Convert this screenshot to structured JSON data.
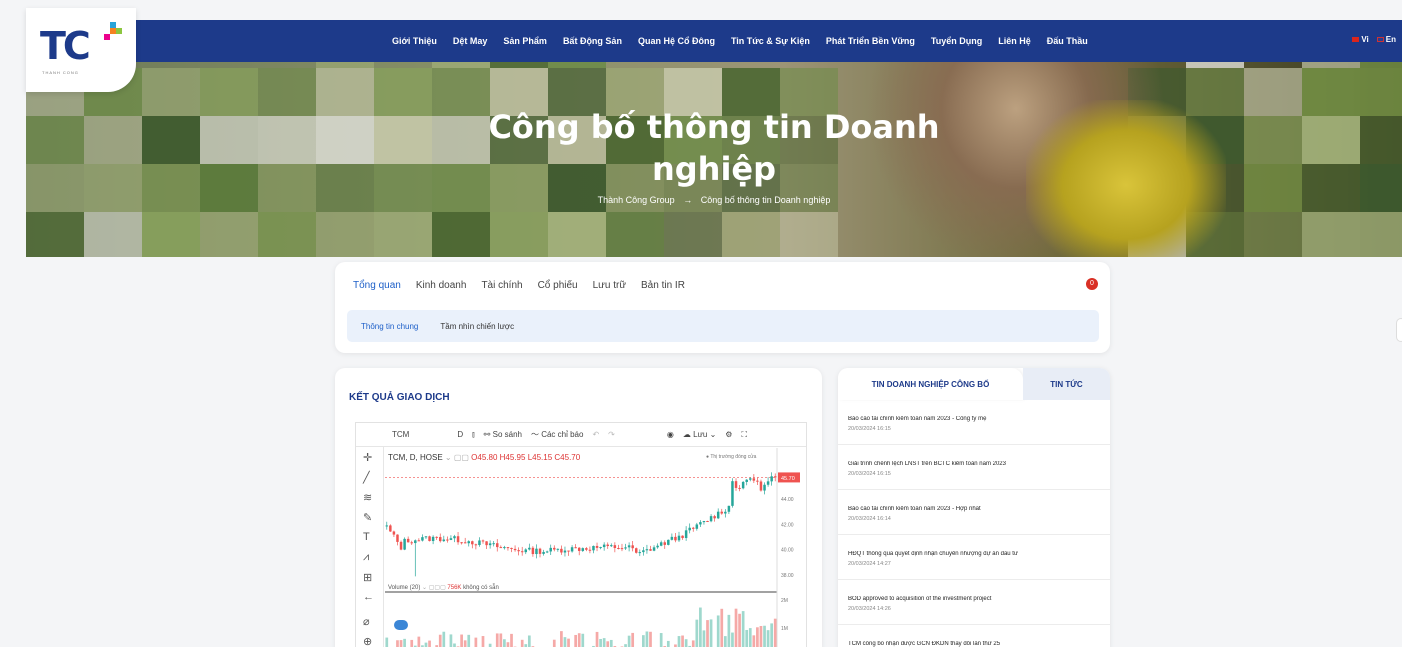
{
  "nav": {
    "items": [
      "Giới Thiệu",
      "Dệt May",
      "Sản Phẩm",
      "Bất Động Sản",
      "Quan Hệ Cổ Đông",
      "Tin Tức & Sự Kiện",
      "Phát Triển Bền Vững",
      "Tuyển Dụng",
      "Liên Hệ",
      "Đấu Thầu"
    ],
    "lang_vi": "Vi",
    "lang_en": "En"
  },
  "logo": {
    "text": "TC",
    "sub": "THANH CONG"
  },
  "hero": {
    "title_line1": "Công bố thông tin Doanh",
    "title_line2": "nghiệp",
    "breadcrumb_home": "Thành Công Group",
    "breadcrumb_sep": "→",
    "breadcrumb_current": "Công bố thông tin Doanh nghiệp"
  },
  "tabs": {
    "main": [
      "Tổng quan",
      "Kinh doanh",
      "Tài chính",
      "Cổ phiếu",
      "Lưu trữ",
      "Bản tin IR"
    ],
    "active_main": 0,
    "sub": [
      "Thông tin chung",
      "Tầm nhìn chiến lược"
    ],
    "active_sub": 0,
    "badge": "0"
  },
  "trading": {
    "title": "KẾT QUẢ GIAO DỊCH",
    "toolbar": {
      "symbol": "TCM",
      "interval": "D",
      "compare": "So sánh",
      "indicators": "Các chỉ báo",
      "save": "Lưu"
    },
    "legend": {
      "name": "TCM, D, HOSE",
      "open": "O45.80",
      "high": "H45.95",
      "low": "L45.15",
      "close": "C45.70"
    },
    "tip": "Thị trường đóng cửa",
    "price_tag": "45.70",
    "y_ticks": [
      "44.00",
      "42.00",
      "40.00",
      "38.00"
    ],
    "vol_ticks": [
      "2M",
      "1M",
      "0"
    ],
    "volume_label": "Volume (20)",
    "volume_value": "756K",
    "volume_na": "không có sẵn"
  },
  "news": {
    "tab_active": "TIN DOANH NGHIỆP CÔNG BỐ",
    "tab_other": "TIN TỨC",
    "items": [
      {
        "title": "Báo cáo tài chính kiểm toán năm 2023 - Công ty mẹ",
        "date": "20/03/2024 16:15"
      },
      {
        "title": "Giải trình chênh lệch LNST trên BCTC kiểm toán năm 2023",
        "date": "20/03/2024 16:15"
      },
      {
        "title": "Báo cáo tài chính kiểm toán năm 2023 - Hợp nhất",
        "date": "20/03/2024 16:14"
      },
      {
        "title": "HĐQT thông qua quyết định nhận chuyển nhượng dự án đầu tư",
        "date": "20/03/2024 14:27"
      },
      {
        "title": "BOD approved to acquisition of the investment project",
        "date": "20/03/2024 14:26"
      },
      {
        "title": "TCM công bố nhận được GCN ĐKDN thay đổi lần thứ 25",
        "date": ""
      }
    ]
  },
  "colors": {
    "nav_bg": "#1d3a8a",
    "up": "#26a69a",
    "down": "#ef5350",
    "accent": "#1d5fc8"
  }
}
